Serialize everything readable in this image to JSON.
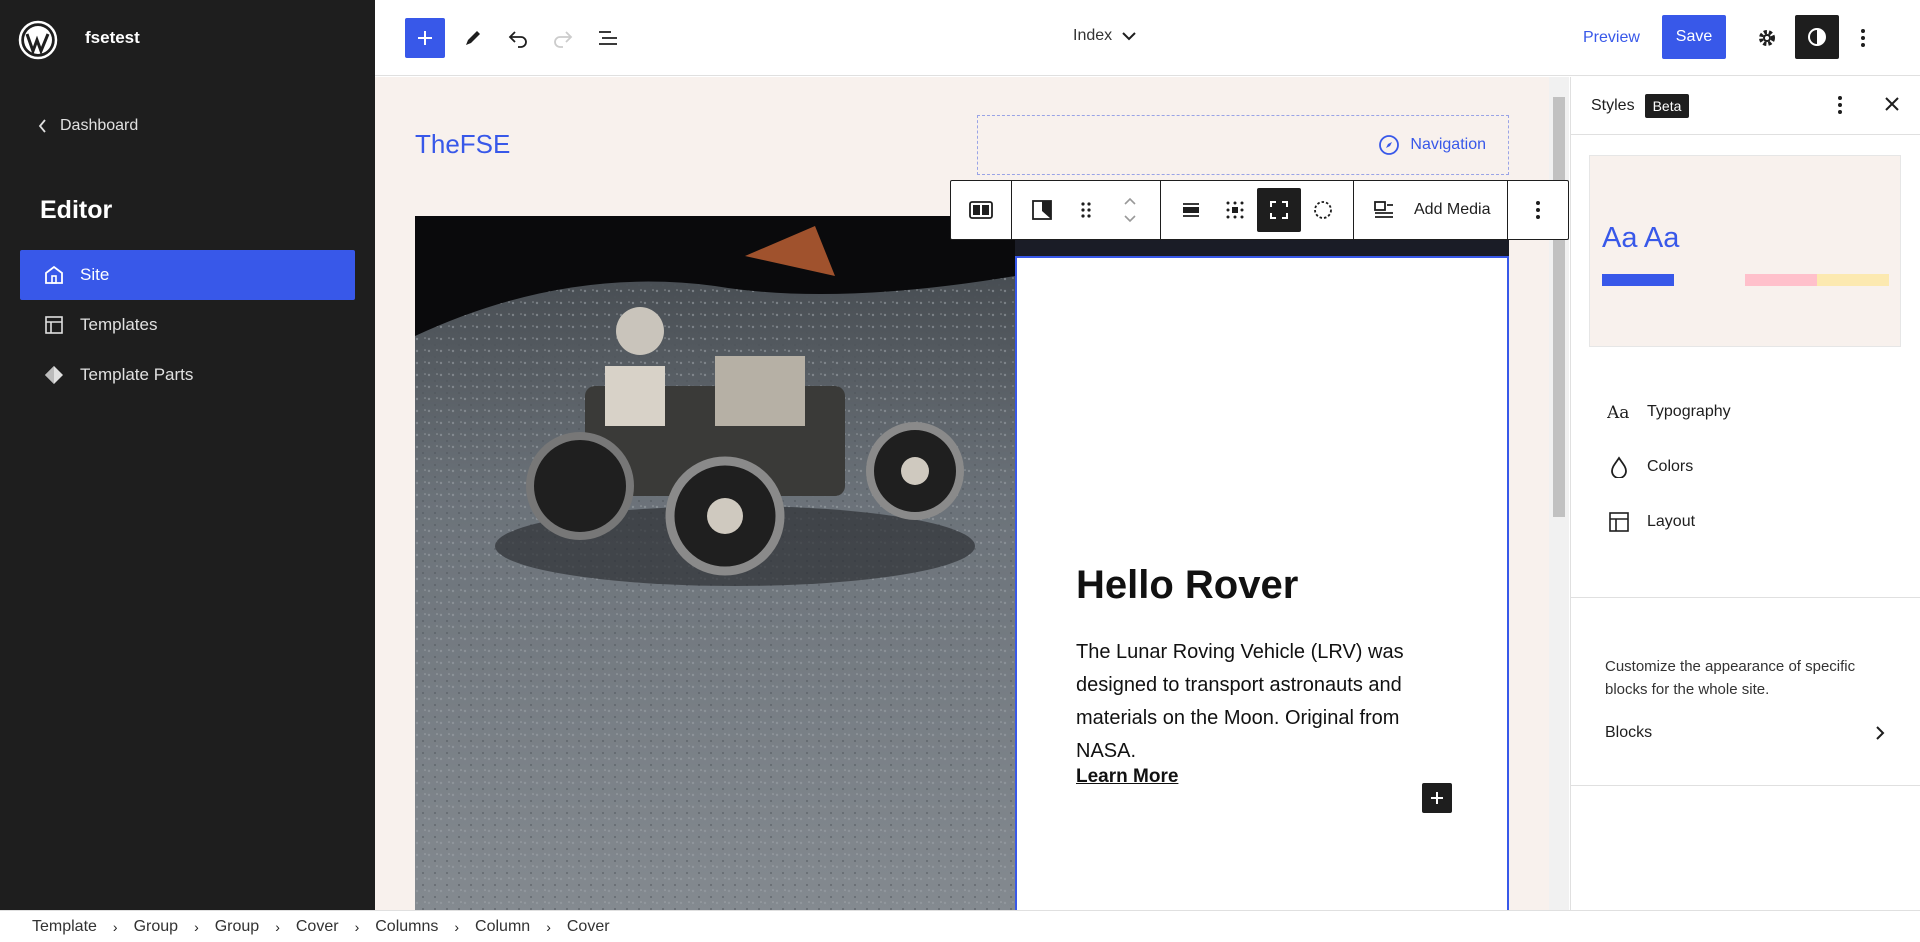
{
  "sidebar": {
    "site_name": "fsetest",
    "dashboard_label": "Dashboard",
    "section_title": "Editor",
    "items": [
      {
        "label": "Site",
        "icon": "home-icon",
        "active": true
      },
      {
        "label": "Templates",
        "icon": "layout-icon",
        "active": false
      },
      {
        "label": "Template Parts",
        "icon": "diamond-icon",
        "active": false
      }
    ]
  },
  "topbar": {
    "template_name": "Index",
    "preview_label": "Preview",
    "save_label": "Save"
  },
  "canvas": {
    "site_title": "TheFSE",
    "navigation_label": "Navigation",
    "heading": "Hello Rover",
    "description": "The Lunar Roving Vehicle (LRV) was designed to transport astronauts and materials on the Moon. Original from NASA.",
    "link_label": "Learn More"
  },
  "block_toolbar": {
    "add_media_label": "Add Media"
  },
  "styles_panel": {
    "title": "Styles",
    "badge": "Beta",
    "preview_text": "Aa Aa",
    "items": [
      {
        "label": "Typography",
        "icon": "typography-icon"
      },
      {
        "label": "Colors",
        "icon": "droplet-icon"
      },
      {
        "label": "Layout",
        "icon": "layout-icon"
      }
    ],
    "help_text": "Customize the appearance of specific blocks for the whole site.",
    "blocks_label": "Blocks",
    "swatches": [
      "#3858e9",
      "#ffc0cb",
      "#fce9b0"
    ]
  },
  "breadcrumb": [
    "Template",
    "Group",
    "Group",
    "Cover",
    "Columns",
    "Column",
    "Cover"
  ],
  "colors": {
    "accent": "#3858e9",
    "sidebar_bg": "#1e1e1e",
    "canvas_bg": "#f8f1ed"
  }
}
